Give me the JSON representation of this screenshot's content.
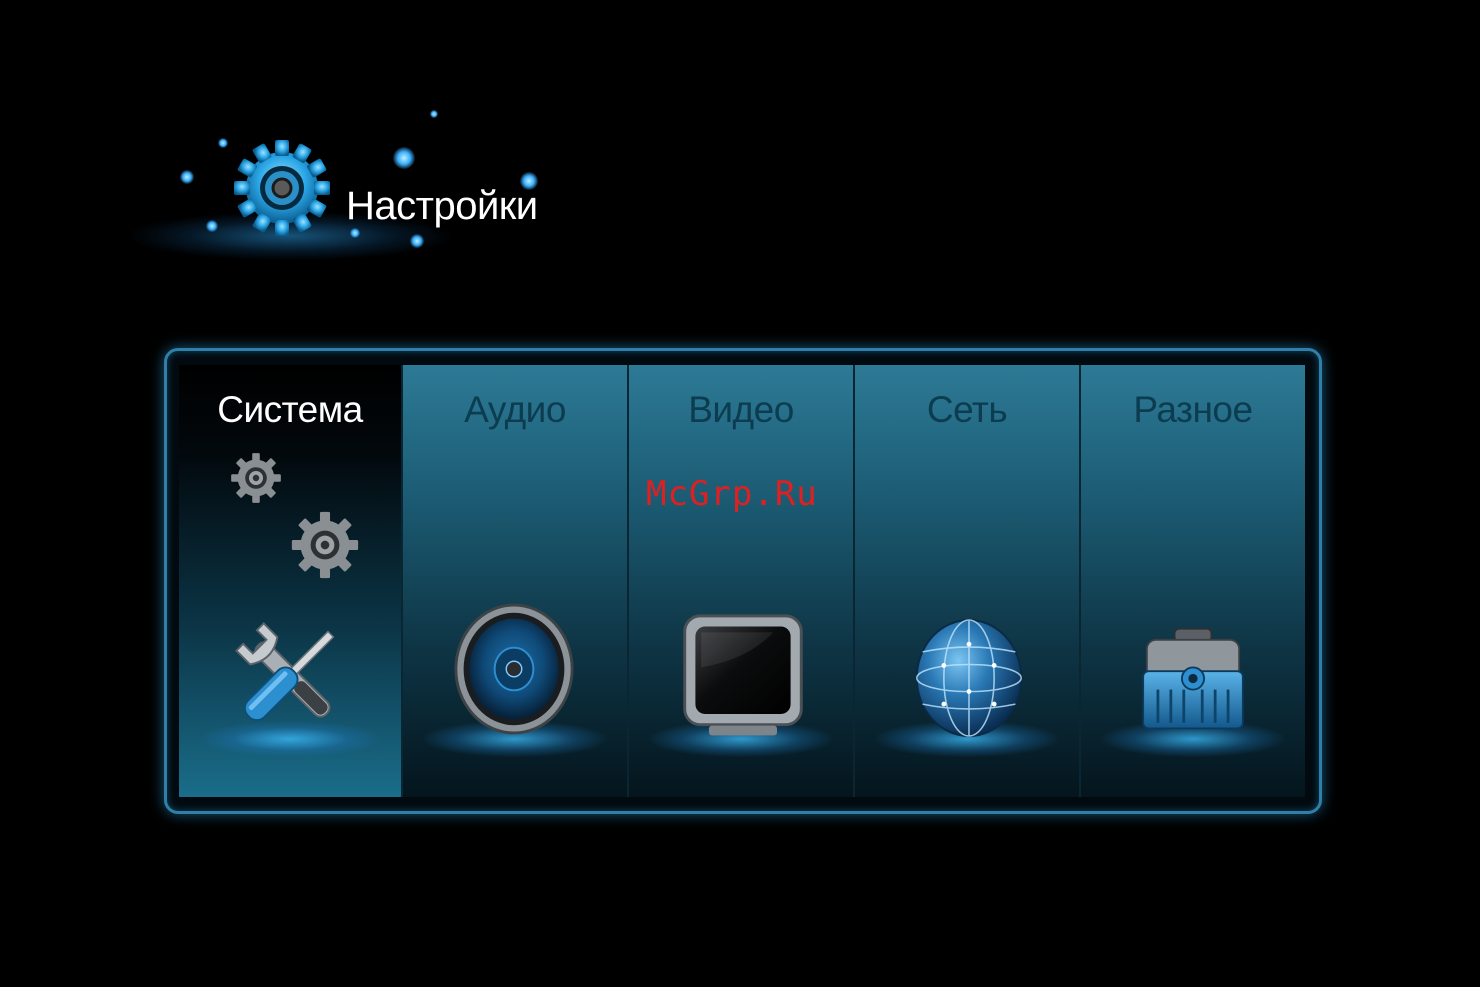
{
  "header": {
    "title": "Настройки",
    "icon": "gear-icon"
  },
  "tabs": [
    {
      "label": "Система",
      "icon": "tools-icon",
      "active": true
    },
    {
      "label": "Аудио",
      "icon": "speaker-icon",
      "active": false
    },
    {
      "label": "Видео",
      "icon": "monitor-icon",
      "active": false
    },
    {
      "label": "Сеть",
      "icon": "globe-icon",
      "active": false
    },
    {
      "label": "Разное",
      "icon": "toolbox-icon",
      "active": false
    }
  ],
  "watermark": "McGrp.Ru",
  "colors": {
    "accent": "#2f7fa8",
    "background": "#000000",
    "active_label": "#ffffff",
    "inactive_label": "#0c3c4f",
    "watermark": "#e02020"
  }
}
